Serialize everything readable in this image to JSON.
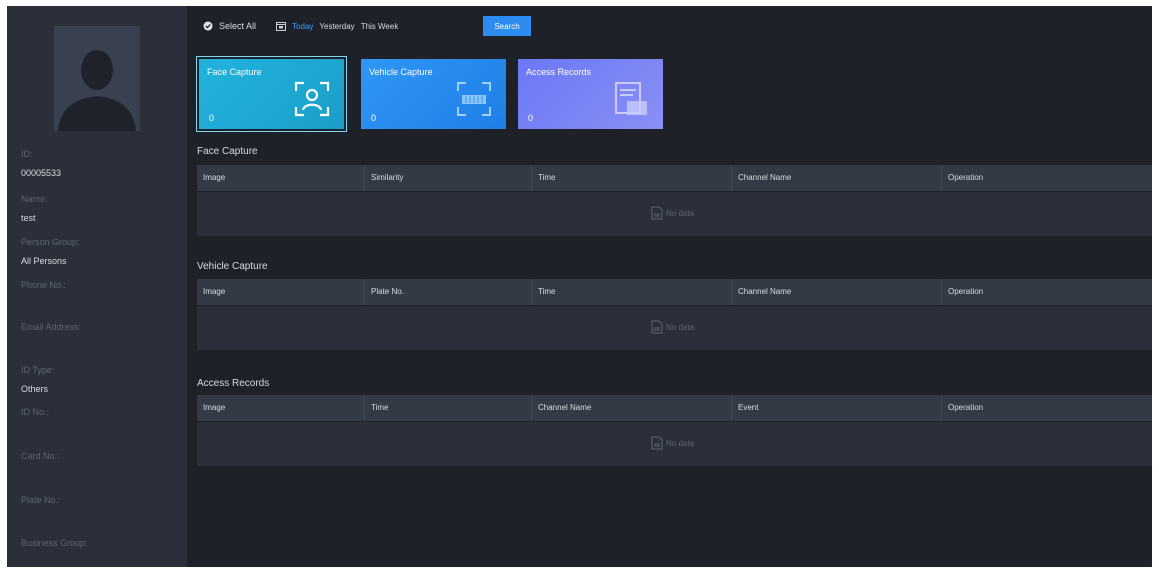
{
  "sidebar": {
    "fields": [
      {
        "label": "ID:",
        "value": "00005533"
      },
      {
        "label": "Name:",
        "value": "test"
      },
      {
        "label": "Person Group:",
        "value": "All Persons"
      },
      {
        "label": "Phone No.:",
        "value": ""
      },
      {
        "label": "Email Address:",
        "value": ""
      },
      {
        "label": "ID Type:",
        "value": "Others"
      },
      {
        "label": "ID No.:",
        "value": ""
      },
      {
        "label": "Card No.:",
        "value": ""
      },
      {
        "label": "Plate No.:",
        "value": ""
      },
      {
        "label": "Business Group:",
        "value": ""
      }
    ]
  },
  "toolbar": {
    "select_all": "Select All",
    "today": "Today",
    "yesterday": "Yesterday",
    "this_week": "This Week",
    "search": "Search"
  },
  "cards": [
    {
      "title": "Face Capture",
      "count": "0",
      "icon": "face-capture-icon"
    },
    {
      "title": "Vehicle Capture",
      "count": "0",
      "icon": "vehicle-capture-icon"
    },
    {
      "title": "Access Records",
      "count": "0",
      "icon": "access-records-icon"
    }
  ],
  "sections": {
    "face": {
      "title": "Face Capture",
      "columns": [
        "Image",
        "Similarity",
        "Time",
        "Channel Name",
        "Operation"
      ],
      "empty": "No data"
    },
    "vehicle": {
      "title": "Vehicle Capture",
      "columns": [
        "Image",
        "Plate No.",
        "Time",
        "Channel Name",
        "Operation"
      ],
      "empty": "No data"
    },
    "access": {
      "title": "Access Records",
      "columns": [
        "Image",
        "Time",
        "Channel Name",
        "Event",
        "Operation"
      ],
      "empty": "No data"
    }
  },
  "colors": {
    "background": "#1e2128",
    "sidebar": "#2a2f39",
    "accent": "#2d8cf0",
    "face_card": "#21b3dd",
    "vehicle_card": "#3097f5",
    "access_card": "#7a82f5"
  }
}
